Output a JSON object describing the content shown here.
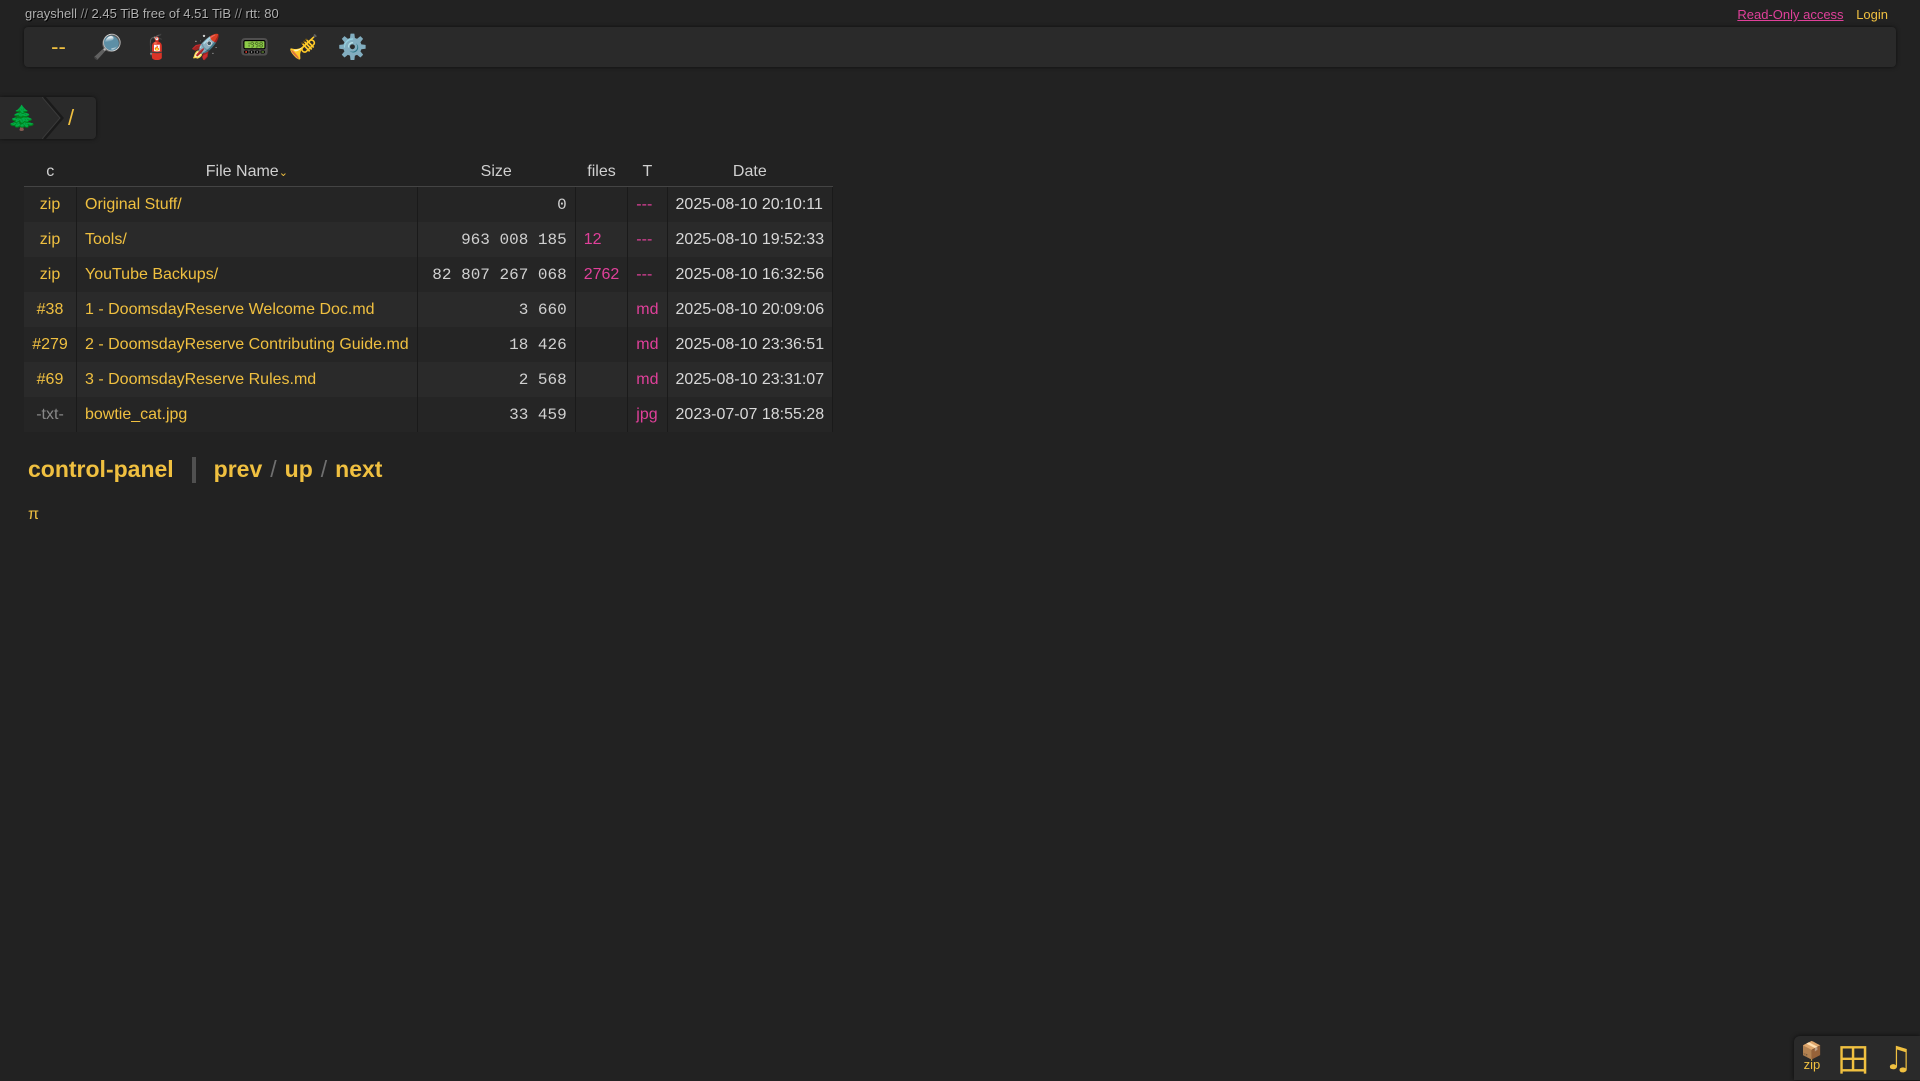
{
  "status": {
    "server": "grayshell",
    "sep1": "//",
    "free": "2.45 TiB free of 4.51 TiB",
    "sep2": "//",
    "rtt": "rtt: 80"
  },
  "auth": {
    "readonly_label": "Read-Only access",
    "login_label": "Login"
  },
  "toolbar": {
    "buttons": [
      {
        "icon": "dash",
        "glyph": "--"
      },
      {
        "icon": "search-icon",
        "glyph": "🔎"
      },
      {
        "icon": "fire-extinguisher-icon",
        "glyph": "🧯"
      },
      {
        "icon": "rocket-icon",
        "glyph": "🚀"
      },
      {
        "icon": "pager-icon",
        "glyph": "📟"
      },
      {
        "icon": "trumpet-icon",
        "glyph": "🎺"
      },
      {
        "icon": "gear-icon",
        "glyph": "⚙️"
      }
    ]
  },
  "breadcrumb": {
    "tree_glyph": "🌲",
    "root": "/"
  },
  "table": {
    "headers": {
      "c": "c",
      "name": "File Name",
      "sort_arrow": "⌄",
      "size": "Size",
      "files": "files",
      "t": "T",
      "date": "Date"
    },
    "rows": [
      {
        "c": "zip",
        "name": "Original Stuff/",
        "size": "0",
        "files": "",
        "t": "---",
        "date": "2025-08-10 20:10:11"
      },
      {
        "c": "zip",
        "name": "Tools/",
        "size": "963 008 185",
        "files": "12",
        "t": "---",
        "date": "2025-08-10 19:52:33"
      },
      {
        "c": "zip",
        "name": "YouTube Backups/",
        "size": "82 807 267 068",
        "files": "2762",
        "t": "---",
        "date": "2025-08-10 16:32:56"
      },
      {
        "c": "#38",
        "name": "1 - DoomsdayReserve Welcome Doc.md",
        "size": "3 660",
        "files": "",
        "t": "md",
        "date": "2025-08-10 20:09:06"
      },
      {
        "c": "#279",
        "name": "2 - DoomsdayReserve Contributing Guide.md",
        "size": "18 426",
        "files": "",
        "t": "md",
        "date": "2025-08-10 23:36:51"
      },
      {
        "c": "#69",
        "name": "3 - DoomsdayReserve Rules.md",
        "size": "2 568",
        "files": "",
        "t": "md",
        "date": "2025-08-10 23:31:07"
      },
      {
        "c": "-txt-",
        "name": "bowtie_cat.jpg",
        "size": "33 459",
        "files": "",
        "t": "jpg",
        "date": "2023-07-07 18:55:28"
      }
    ]
  },
  "nav": {
    "control_panel": "control-panel",
    "prev": "prev",
    "slash": "/",
    "up": "up",
    "next": "next"
  },
  "footer": {
    "pi": "π"
  },
  "dock": {
    "zip_glyph": "📦",
    "zip_label": "zip",
    "grid_glyph": "田",
    "music_glyph": "♫"
  },
  "colors": {
    "background": "#222222",
    "accent": "#f0c040",
    "pink": "#e0409a"
  }
}
